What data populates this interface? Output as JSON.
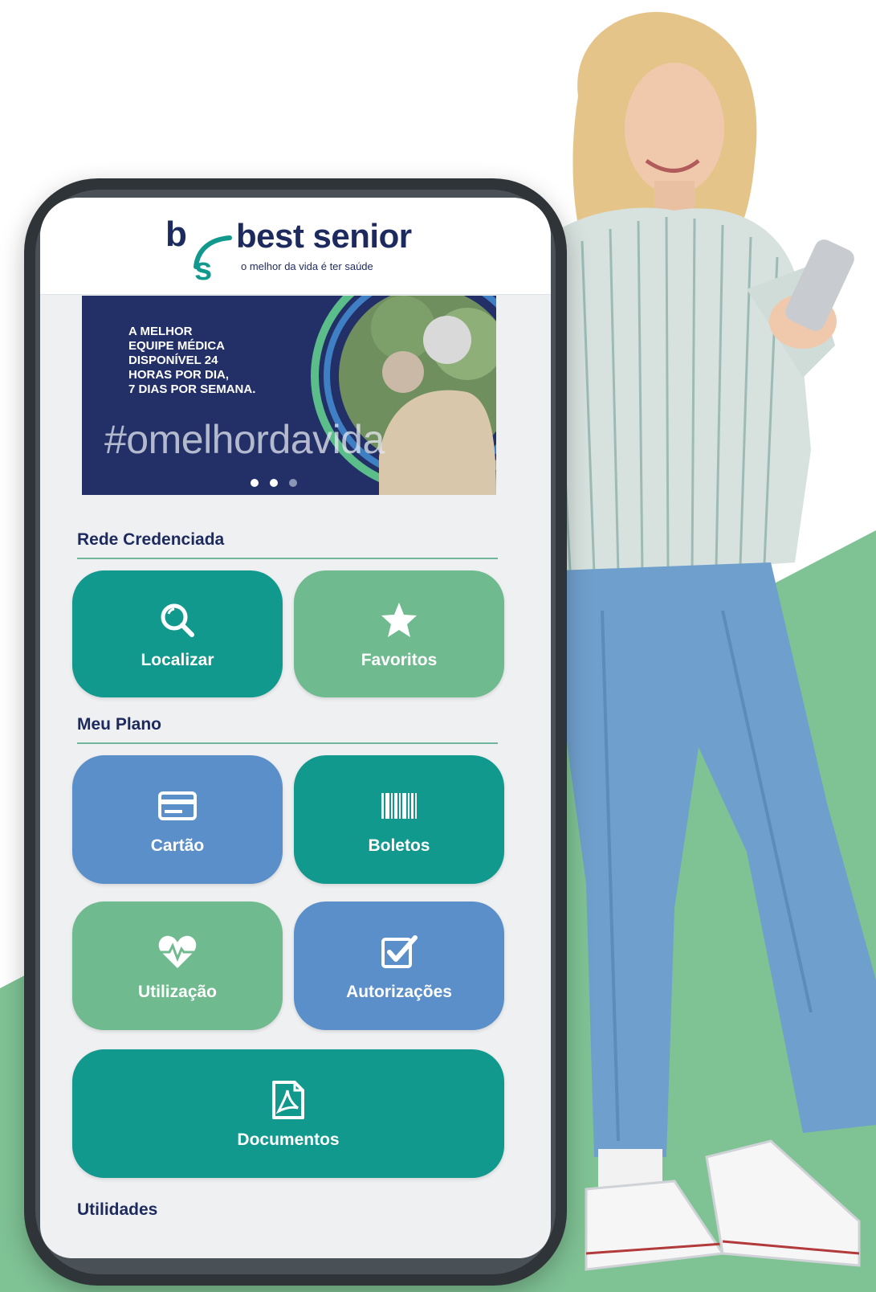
{
  "colors": {
    "navy": "#1d2a5e",
    "teal": "#12998e",
    "green": "#6fba8e",
    "blue": "#5b8fc9",
    "background_green": "#7fc294"
  },
  "header": {
    "logo_letters": "b/s",
    "brand_name": "best senior",
    "tagline": "o melhor da vida é ter saúde"
  },
  "banner": {
    "lines": [
      "A MELHOR",
      "EQUIPE MÉDICA",
      "DISPONÍVEL 24",
      "HORAS POR DIA,",
      "7 DIAS POR SEMANA."
    ],
    "hashtag": "#omelhordavida",
    "carousel": {
      "total": 3,
      "active_index": 1
    }
  },
  "sections": {
    "rede": {
      "title": "Rede Credenciada",
      "localizar": {
        "label": "Localizar",
        "icon": "search-icon"
      },
      "favoritos": {
        "label": "Favoritos",
        "icon": "star-icon"
      }
    },
    "plano": {
      "title": "Meu Plano",
      "cartao": {
        "label": "Cartão",
        "icon": "card-icon"
      },
      "boletos": {
        "label": "Boletos",
        "icon": "barcode-icon"
      },
      "utilizacao": {
        "label": "Utilização",
        "icon": "heartbeat-icon"
      },
      "autorizacoes": {
        "label": "Autorizações",
        "icon": "checkbox-icon"
      },
      "documentos": {
        "label": "Documentos",
        "icon": "pdf-icon"
      }
    },
    "utilidades": {
      "title": "Utilidades"
    }
  }
}
